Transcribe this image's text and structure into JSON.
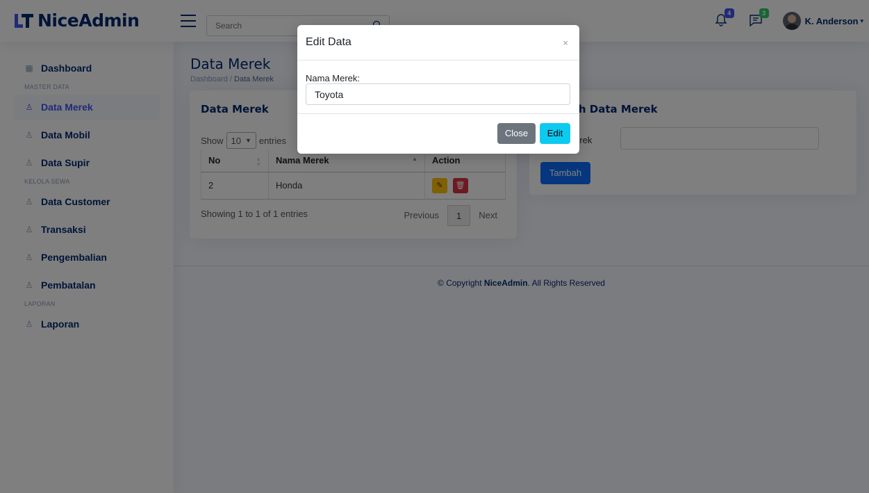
{
  "brand": {
    "name": "NiceAdmin"
  },
  "header": {
    "search_placeholder": "Search",
    "notifications_count": "4",
    "messages_count": "3",
    "user_name": "K. Anderson"
  },
  "sidebar": {
    "items": [
      {
        "label": "Dashboard",
        "icon": "grid-icon"
      },
      {
        "heading": "MASTER DATA"
      },
      {
        "label": "Data Merek",
        "icon": "person-icon",
        "active": true
      },
      {
        "label": "Data Mobil",
        "icon": "person-icon"
      },
      {
        "label": "Data Supir",
        "icon": "person-icon"
      },
      {
        "heading": "KELOLA SEWA"
      },
      {
        "label": "Data Customer",
        "icon": "person-icon"
      },
      {
        "label": "Transaksi",
        "icon": "person-icon"
      },
      {
        "label": "Pengembalian",
        "icon": "person-icon"
      },
      {
        "label": "Pembatalan",
        "icon": "person-icon"
      },
      {
        "heading": "LAPORAN"
      },
      {
        "label": "Laporan",
        "icon": "person-icon"
      }
    ]
  },
  "page": {
    "title": "Data Merek",
    "breadcrumb_home": "Dashboard",
    "breadcrumb_sep": "/",
    "breadcrumb_current": "Data Merek"
  },
  "table_card": {
    "title": "Data Merek",
    "show_label": "Show",
    "entries_value": "10",
    "entries_label": "entries",
    "columns": [
      "No",
      "Nama Merek",
      "Action"
    ],
    "rows": [
      {
        "no": "2",
        "nama": "Honda"
      }
    ],
    "info": "Showing 1 to 1 of 1 entries",
    "prev": "Previous",
    "page": "1",
    "next": "Next"
  },
  "form_card": {
    "title": "Tambah Data Merek",
    "label": "Nama Merek",
    "submit": "Tambah"
  },
  "footer": {
    "prefix": "© Copyright",
    "brand": "NiceAdmin",
    "suffix": ". All Rights Reserved"
  },
  "modal": {
    "title": "Edit Data",
    "close_glyph": "×",
    "field_label": "Nama Merek:",
    "field_value": "Toyota",
    "close_button": "Close",
    "edit_button": "Edit"
  },
  "colors": {
    "brand": "#012970",
    "accent": "#4154f1",
    "primary": "#0d6efd",
    "info": "#0dcaf0",
    "secondary": "#6c757d",
    "warning": "#ffc107",
    "danger": "#dc3545"
  }
}
